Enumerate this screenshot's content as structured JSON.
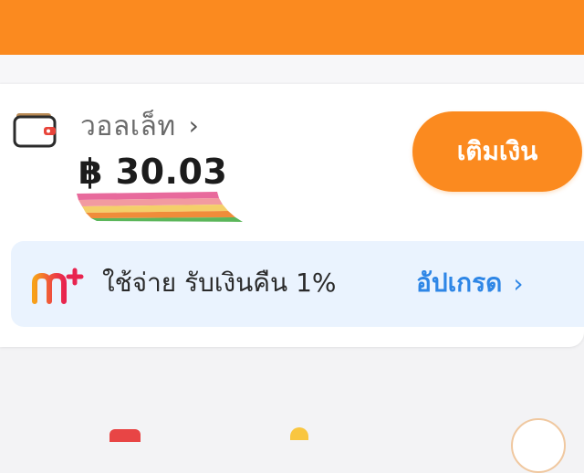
{
  "wallet": {
    "title": "วอลเล็ท",
    "chevron": "›",
    "balance": "฿ 30.03",
    "icon": "wallet-icon",
    "topup_label": "เติมเงิน"
  },
  "promo": {
    "icon": "mplus-logo-icon",
    "text": "ใช้จ่าย รับเงินคืน 1%",
    "upgrade_label": "อัปเกรด",
    "chevron": "›"
  },
  "colors": {
    "accent": "#fb8a1f",
    "link_blue": "#2e86e6",
    "promo_bg": "#eaf3fe"
  }
}
